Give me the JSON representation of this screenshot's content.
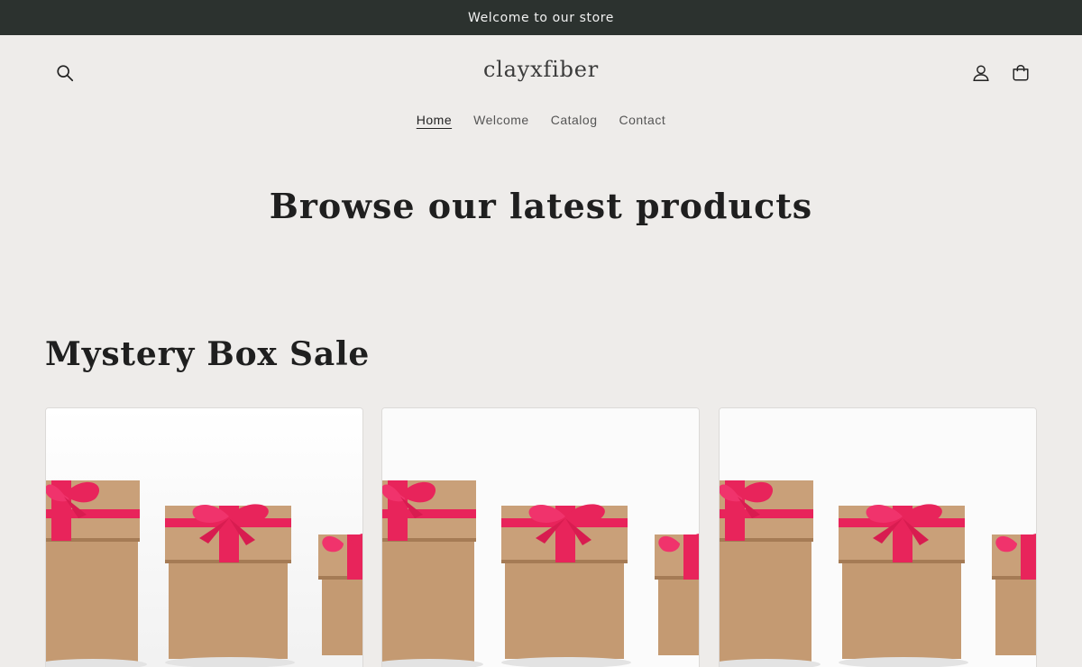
{
  "announcement": {
    "text": "Welcome to our store"
  },
  "header": {
    "logo": "clayxfiber",
    "icons": {
      "search": "search-icon",
      "account": "account-icon",
      "cart": "cart-icon"
    }
  },
  "nav": {
    "items": [
      {
        "label": "Home",
        "active": true
      },
      {
        "label": "Welcome",
        "active": false
      },
      {
        "label": "Catalog",
        "active": false
      },
      {
        "label": "Contact",
        "active": false
      }
    ]
  },
  "hero": {
    "title": "Browse our latest products"
  },
  "collection": {
    "title": "Mystery Box Sale",
    "products": [
      {
        "image": "gift-boxes-image"
      },
      {
        "image": "gift-boxes-image"
      },
      {
        "image": "gift-boxes-image"
      }
    ]
  },
  "colors": {
    "announcement_bg": "#2c322f",
    "page_bg": "#eeecea",
    "box_kraft": "#c49a72",
    "ribbon": "#e8245b"
  }
}
